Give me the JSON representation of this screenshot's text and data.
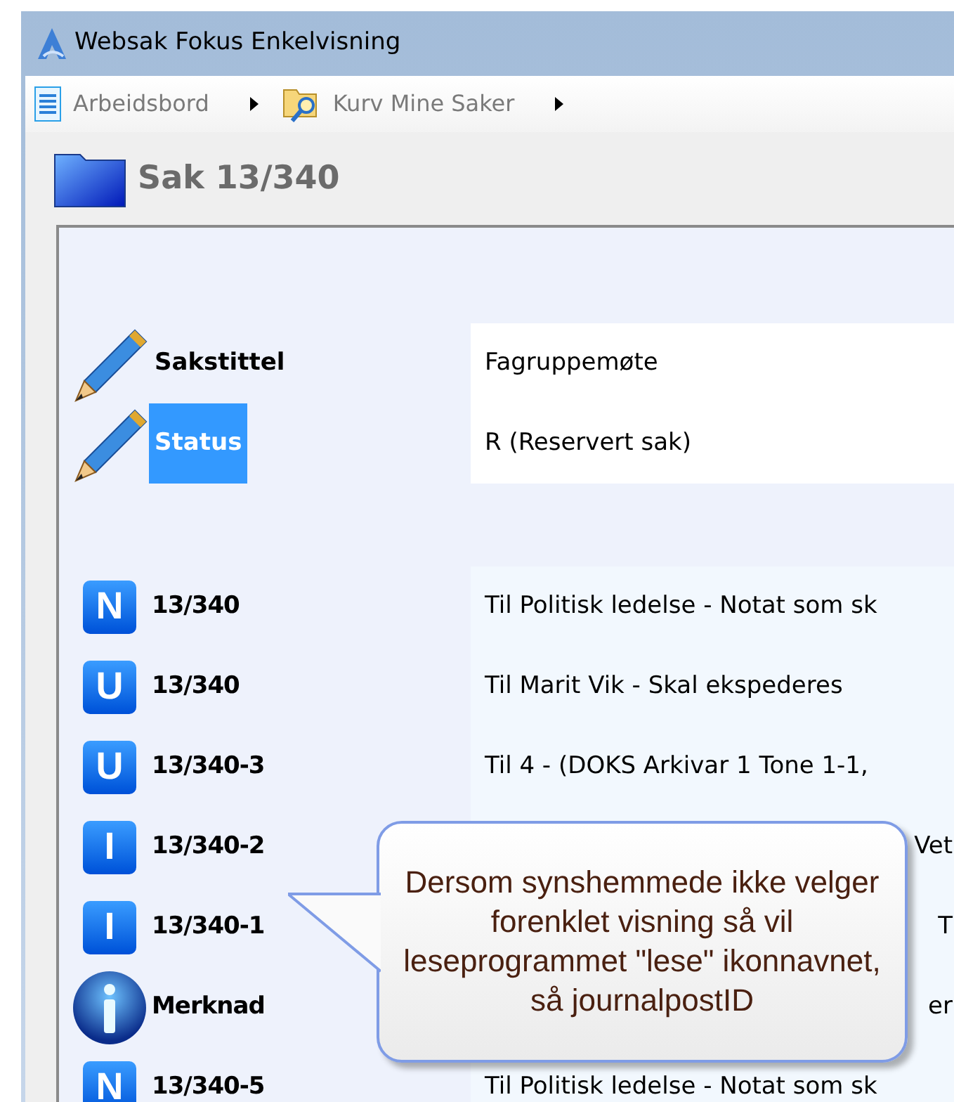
{
  "window": {
    "title": "Websak Fokus Enkelvisning"
  },
  "breadcrumbs": [
    {
      "label": "Arbeidsbord",
      "kind": "document"
    },
    {
      "label": "Kurv Mine Saker",
      "kind": "folder-search"
    }
  ],
  "header": {
    "title": "Sak 13/340"
  },
  "fields": [
    {
      "label": "Sakstittel",
      "value": "Fagruppemøte",
      "selected": false
    },
    {
      "label": "Status",
      "value": "R (Reservert sak)",
      "selected": true
    }
  ],
  "entries": [
    {
      "kind": "letter",
      "letter": "N",
      "label": "13/340",
      "value": "Til Politisk ledelse - Notat som sk"
    },
    {
      "kind": "letter",
      "letter": "U",
      "label": "13/340",
      "value": "Til Marit Vik - Skal ekspederes"
    },
    {
      "kind": "letter",
      "letter": "U",
      "label": "13/340-3",
      "value": "Til 4 - (DOKS Arkivar 1 Tone 1-1,"
    },
    {
      "kind": "letter",
      "letter": "I",
      "label": "13/340-2",
      "value": "Vet"
    },
    {
      "kind": "letter",
      "letter": "I",
      "label": "13/340-1",
      "value": "T"
    },
    {
      "kind": "info",
      "label": "Merknad",
      "value": "er"
    },
    {
      "kind": "letter",
      "letter": "N",
      "label": "13/340-5",
      "value": "Til Politisk ledelse - Notat som sk"
    }
  ],
  "callout": {
    "text": "Dersom synshemmede ikke velger forenklet visning så vil leseprogrammet \"lese\" ikonnavnet, så journalpostID"
  }
}
